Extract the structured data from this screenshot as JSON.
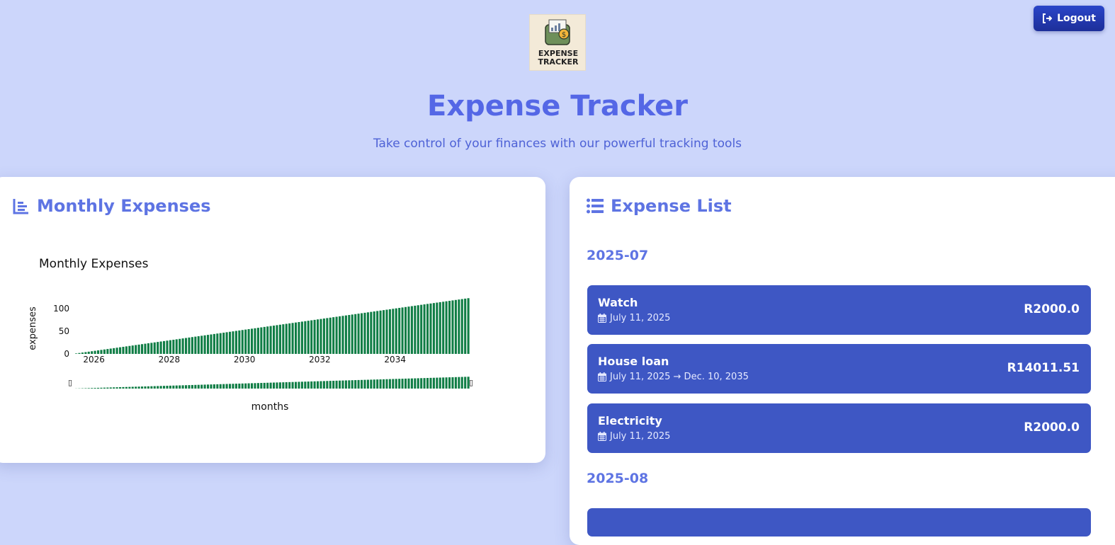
{
  "header": {
    "logout_label": "Logout",
    "logo_text_line1": "EXPENSE",
    "logo_text_line2": "TRACKER",
    "title": "Expense Tracker",
    "subtitle": "Take control of your finances with our powerful tracking tools"
  },
  "monthly_card": {
    "title": "Monthly Expenses"
  },
  "list_card": {
    "title": "Expense List"
  },
  "groups": [
    {
      "month": "2025-07",
      "items": [
        {
          "name": "Watch",
          "date": "July 11, 2025",
          "amount": "R2000.0"
        },
        {
          "name": "House loan",
          "date": "July 11, 2025 → Dec. 10, 2035",
          "amount": "R14011.51"
        },
        {
          "name": "Electricity",
          "date": "July 11, 2025",
          "amount": "R2000.0"
        }
      ]
    },
    {
      "month": "2025-08",
      "items": []
    }
  ],
  "colors": {
    "accent": "#5467e6",
    "item_bg": "#3e57c4",
    "bar": "#0f7d45",
    "page_bg": "#ccd6fb"
  },
  "chart_data": {
    "type": "bar",
    "title": "Monthly Expenses",
    "xlabel": "months",
    "ylabel": "expenses",
    "x_start": "2025-07",
    "x_ticks": [
      "2026",
      "2028",
      "2030",
      "2032",
      "2034"
    ],
    "y_ticks": [
      0,
      50,
      100
    ],
    "ylim": [
      0,
      125
    ],
    "values_description_start": 1,
    "values_description_end": 123,
    "range_slider": true,
    "range_slider_handles": [
      "▯",
      "▯"
    ]
  }
}
